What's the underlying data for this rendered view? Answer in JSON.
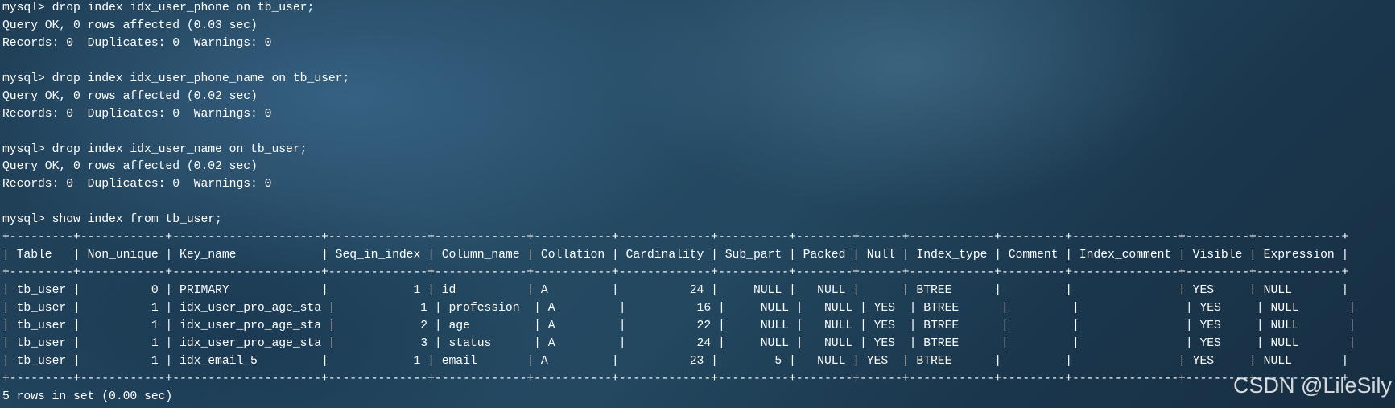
{
  "terminal": {
    "lines": [
      "mysql> drop index idx_user_phone on tb_user;",
      "Query OK, 0 rows affected (0.03 sec)",
      "Records: 0  Duplicates: 0  Warnings: 0",
      "",
      "mysql> drop index idx_user_phone_name on tb_user;",
      "Query OK, 0 rows affected (0.02 sec)",
      "Records: 0  Duplicates: 0  Warnings: 0",
      "",
      "mysql> drop index idx_user_name on tb_user;",
      "Query OK, 0 rows affected (0.02 sec)",
      "Records: 0  Duplicates: 0  Warnings: 0",
      "",
      "mysql> show index from tb_user;",
      "+---------+------------+---------------------+--------------+-------------+-----------+-------------+----------+--------+------+------------+---------+---------------+---------+------------+",
      "| Table   | Non_unique | Key_name            | Seq_in_index | Column_name | Collation | Cardinality | Sub_part | Packed | Null | Index_type | Comment | Index_comment | Visible | Expression |",
      "+---------+------------+---------------------+--------------+-------------+-----------+-------------+----------+--------+------+------------+---------+---------------+---------+------------+",
      "| tb_user |          0 | PRIMARY             |            1 | id          | A         |          24 |     NULL |   NULL |      | BTREE      |         |               | YES     | NULL       |",
      "| tb_user |          1 | idx_user_pro_age_sta |            1 | profession  | A         |          16 |     NULL |   NULL | YES  | BTREE      |         |               | YES     | NULL       |",
      "| tb_user |          1 | idx_user_pro_age_sta |            2 | age         | A         |          22 |     NULL |   NULL | YES  | BTREE      |         |               | YES     | NULL       |",
      "| tb_user |          1 | idx_user_pro_age_sta |            3 | status      | A         |          24 |     NULL |   NULL | YES  | BTREE      |         |               | YES     | NULL       |",
      "| tb_user |          1 | idx_email_5         |            1 | email       | A         |          23 |        5 |   NULL | YES  | BTREE      |         |               | YES     | NULL       |",
      "+---------+------------+---------------------+--------------+-------------+-----------+-------------+----------+--------+------+------------+---------+---------------+---------+------------+",
      "5 rows in set (0.00 sec)"
    ]
  },
  "watermark": {
    "text": "CSDN @LileSily"
  }
}
